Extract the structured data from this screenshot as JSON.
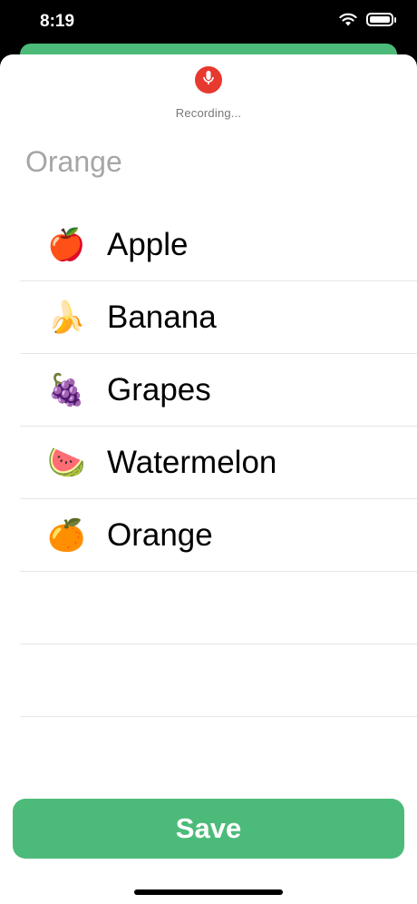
{
  "status_bar": {
    "time": "8:19",
    "icons": [
      "wifi-icon",
      "battery-icon"
    ]
  },
  "recorder": {
    "icon": "microphone-icon",
    "status": "Recording...",
    "color": "#e8392f"
  },
  "search": {
    "value": "Orange"
  },
  "items": [
    {
      "emoji": "🍎",
      "label": "Apple"
    },
    {
      "emoji": "🍌",
      "label": "Banana"
    },
    {
      "emoji": "🍇",
      "label": "Grapes"
    },
    {
      "emoji": "🍉",
      "label": "Watermelon"
    },
    {
      "emoji": "🍊",
      "label": "Orange"
    },
    {
      "emoji": "",
      "label": ""
    },
    {
      "emoji": "",
      "label": ""
    }
  ],
  "save": {
    "label": "Save",
    "color": "#4cbb7a"
  }
}
